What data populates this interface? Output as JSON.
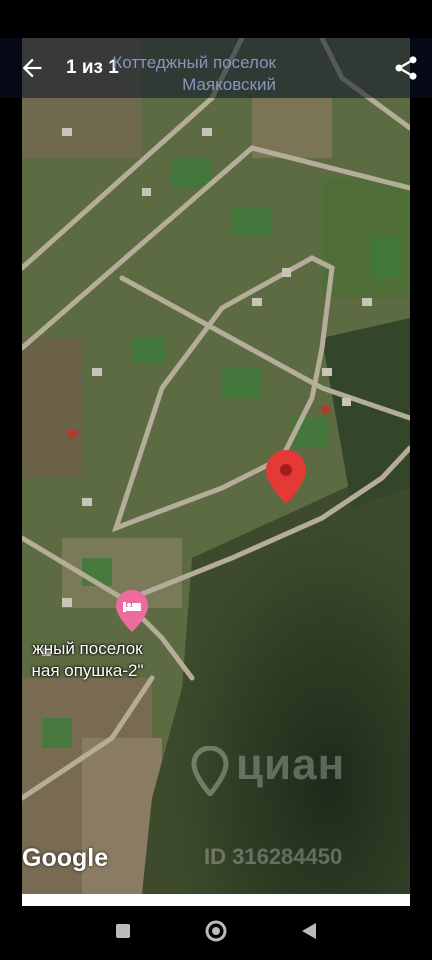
{
  "header": {
    "counter": "1 из 1",
    "title": "Коттеджный поселок Маяковский"
  },
  "icons": {
    "back": "arrow-back-icon",
    "share": "share-icon",
    "pin": "location-pin-icon",
    "hotel": "hotel-bed-icon"
  },
  "map": {
    "place_label_line1": "жный поселок",
    "place_label_line2": "ная опушка-2\"",
    "attribution": "Google"
  },
  "watermark": {
    "brand": "циан",
    "listing_id": "ID 316284450"
  },
  "colors": {
    "pin": "#e53935",
    "hotel_marker": "#ec6c9e",
    "topbar_overlay": "#0a1228"
  },
  "navbar": {
    "buttons": [
      "recents-button",
      "home-button",
      "back-nav-button"
    ]
  }
}
